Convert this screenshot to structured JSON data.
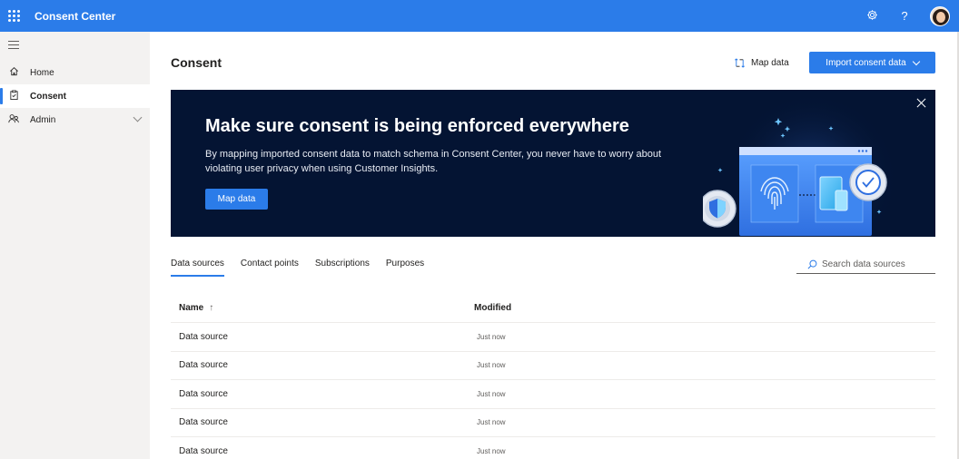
{
  "app": {
    "title": "Consent Center"
  },
  "topbar": {
    "settings_icon": "gear-icon",
    "help_label": "?"
  },
  "sidebar": {
    "items": [
      {
        "label": "Home",
        "icon": "home-icon"
      },
      {
        "label": "Consent",
        "icon": "clipboard-icon",
        "active": true
      },
      {
        "label": "Admin",
        "icon": "people-icon",
        "expandable": true
      }
    ]
  },
  "page": {
    "title": "Consent",
    "map_data_label": "Map data",
    "import_label": "Import consent data"
  },
  "banner": {
    "title": "Make sure consent is being enforced everywhere",
    "text": "By mapping imported consent data to match schema in Consent Center, you never have to worry about violating user privacy when using Customer Insights.",
    "button_label": "Map data"
  },
  "tabs": [
    "Data sources",
    "Contact points",
    "Subscriptions",
    "Purposes"
  ],
  "search": {
    "placeholder": "Search data sources"
  },
  "table": {
    "columns": [
      "Name",
      "Modified"
    ],
    "sort_indicator": "↑",
    "rows": [
      {
        "name": "Data source",
        "modified": "Just now"
      },
      {
        "name": "Data source",
        "modified": "Just now"
      },
      {
        "name": "Data source",
        "modified": "Just now"
      },
      {
        "name": "Data source",
        "modified": "Just now"
      },
      {
        "name": "Data source",
        "modified": "Just now"
      }
    ]
  },
  "colors": {
    "accent": "#2b7ce9",
    "banner_bg": "#041433",
    "sidebar_bg": "#f3f2f1"
  }
}
